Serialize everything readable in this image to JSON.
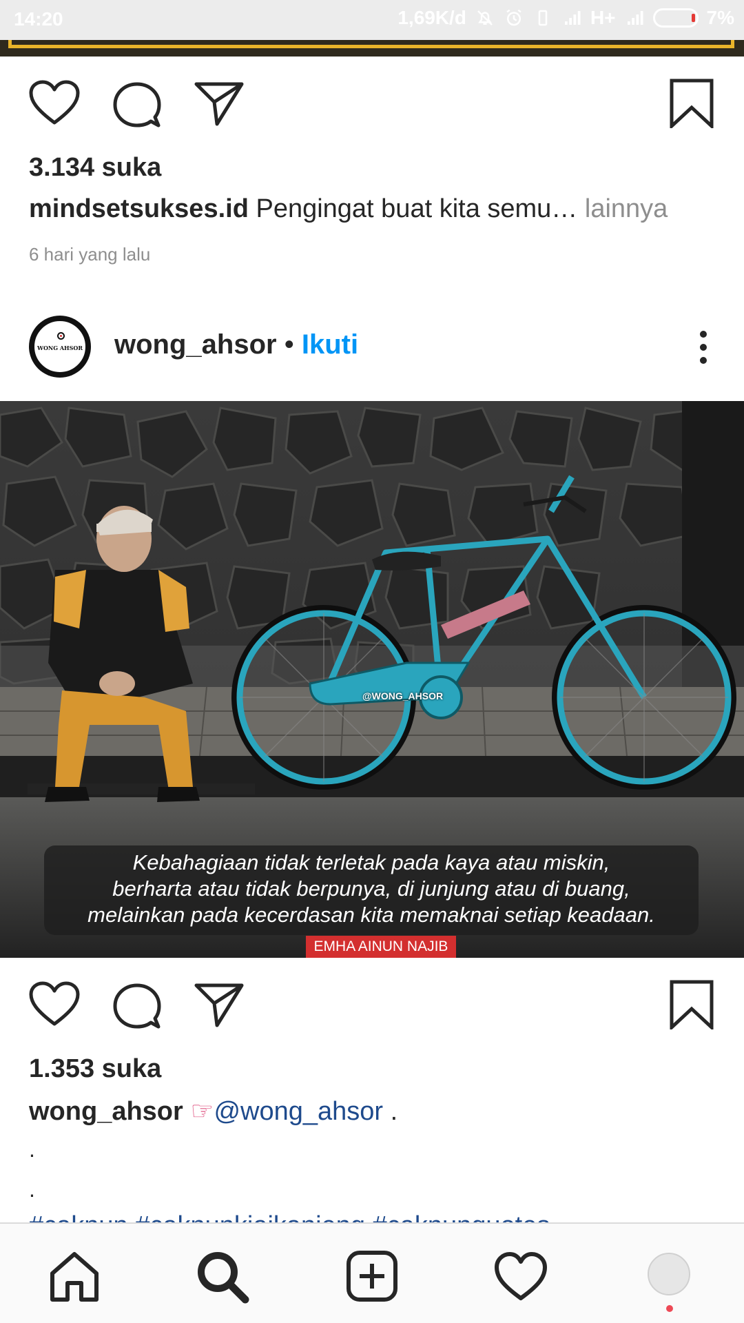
{
  "status_bar": {
    "time": "14:20",
    "network_speed": "1,69K/d",
    "network_type": "H+",
    "battery": "7%",
    "icons": [
      "alarm-off-icon",
      "alarm-icon",
      "vibrate-icon",
      "signal-icon",
      "signal-icon"
    ]
  },
  "post1": {
    "likes": "3.134 suka",
    "caption_user": "mindsetsukses.id",
    "caption_text": "Pengingat buat kita semu…",
    "more_label": "lainnya",
    "timestamp": "6 hari yang lalu"
  },
  "post2": {
    "username": "wong_ahsor",
    "separator": "•",
    "follow_label": "Ikuti",
    "avatar_text": "WONG AHSOR",
    "image": {
      "watermark": "@WONG_AHSOR",
      "quote_lines": [
        "Kebahagiaan tidak terletak pada kaya atau miskin,",
        "berharta atau tidak berpunya, di junjung atau di buang,",
        "melainkan pada kecerdasan kita memaknai setiap keadaan."
      ],
      "author": "EMHA AINUN NAJIB"
    },
    "likes": "1.353 suka",
    "caption_user": "wong_ahsor",
    "caption_emoji": "☞",
    "caption_mention": "@wong_ahsor",
    "caption_tail": " .",
    "dot_lines": [
      ".",
      "."
    ],
    "hashtags": "#caknun #caknunkiaikanjeng #caknunquotes"
  },
  "nav": {
    "items": [
      "home-icon",
      "search-icon",
      "new-post-icon",
      "activity-icon",
      "profile-avatar"
    ]
  },
  "colors": {
    "follow_blue": "#0095f6",
    "mention_blue": "#1e4a8c",
    "author_badge_red": "#d32f2f",
    "notification_dot": "#ed4956",
    "frame_gold": "#e9b42a"
  }
}
